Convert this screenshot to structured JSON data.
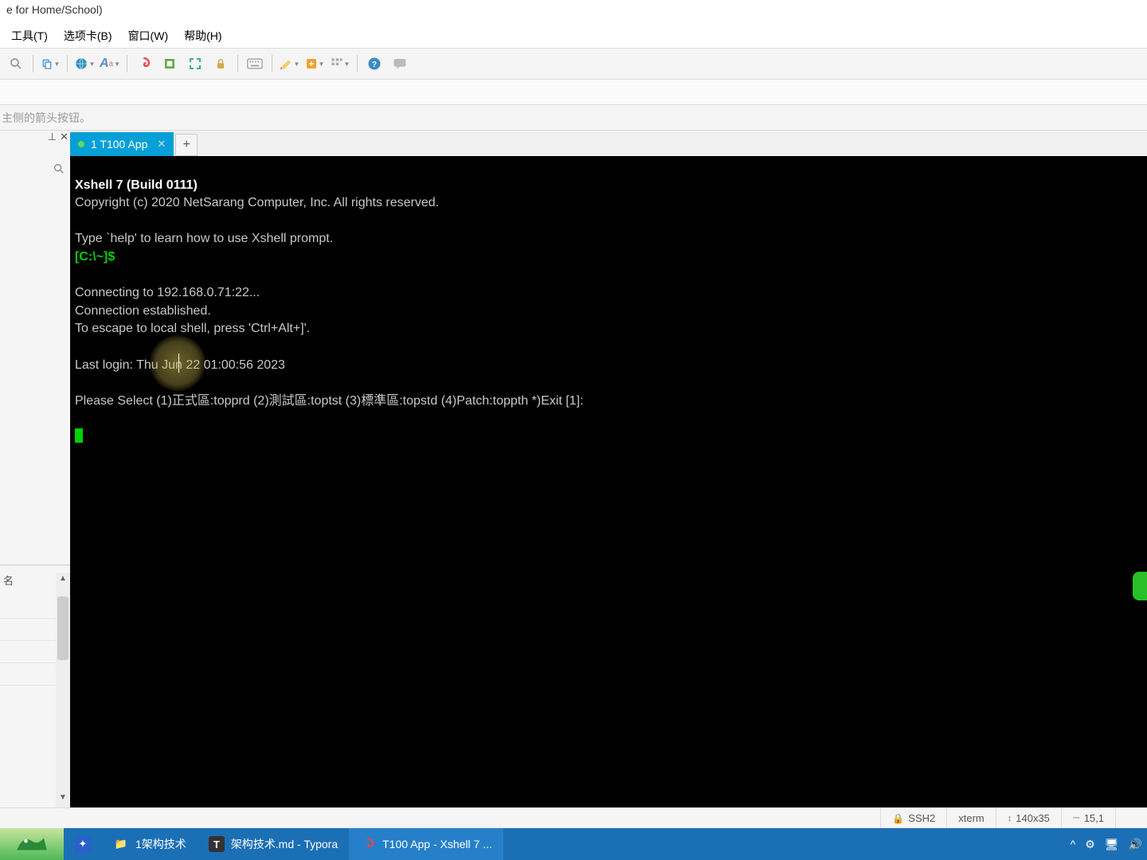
{
  "title_suffix": "e for Home/School)",
  "menu": {
    "tools": "工具(T)",
    "tabs": "选项卡(B)",
    "window": "窗口(W)",
    "help": "帮助(H)"
  },
  "hint": "主侧的箭头按钮。",
  "left": {
    "label": "名"
  },
  "tab": {
    "label": "1 T100 App"
  },
  "terminal": {
    "line1": "Xshell 7 (Build 0111)",
    "line2": "Copyright (c) 2020 NetSarang Computer, Inc. All rights reserved.",
    "line3": "",
    "line4": "Type `help' to learn how to use Xshell prompt.",
    "prompt": "[C:\\~]$",
    "line6": "",
    "line7": "Connecting to 192.168.0.71:22...",
    "line8": "Connection established.",
    "line9": "To escape to local shell, press 'Ctrl+Alt+]'.",
    "line10": "",
    "line11": "Last login: Thu Jun 22 01:00:56 2023",
    "line12": "",
    "line13": "Please Select (1)正式區:topprd (2)測試區:toptst (3)標準區:topstd (4)Patch:toppth *)Exit [1]:"
  },
  "status": {
    "ssh": "SSH2",
    "term": "xterm",
    "size": "140x35",
    "pos": "15,1"
  },
  "taskbar": {
    "app1": "1架构技术",
    "app2": "架构技术.md - Typora",
    "app3": "T100 App - Xshell 7 ..."
  }
}
